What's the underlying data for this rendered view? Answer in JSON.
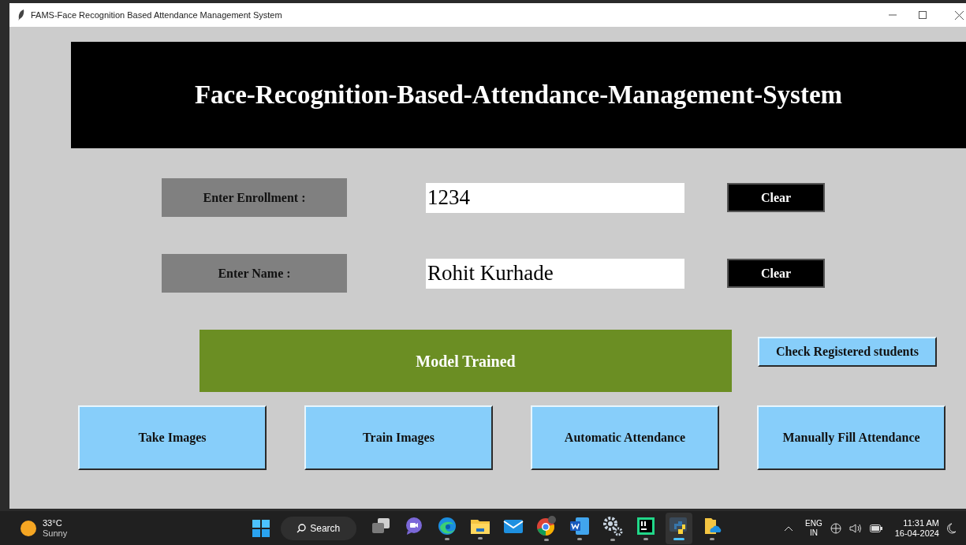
{
  "window": {
    "title": "FAMS-Face Recognition Based Attendance Management System"
  },
  "banner": {
    "title": "Face-Recognition-Based-Attendance-Management-System"
  },
  "fields": [
    {
      "label": "Enter Enrollment :",
      "value": "1234",
      "button": "Clear"
    },
    {
      "label": "Enter Name :",
      "value": "Rohit Kurhade",
      "button": "Clear"
    }
  ],
  "status": {
    "text": "Model Trained"
  },
  "check_button": "Check Registered students",
  "actions": [
    "Take Images",
    "Train Images",
    "Automatic Attendance",
    "Manually Fill Attendance"
  ],
  "taskbar": {
    "weather": {
      "temperature": "33°C",
      "condition": "Sunny"
    },
    "search": "Search",
    "apps": [
      {
        "kind": "taskview",
        "running": false,
        "selected": false
      },
      {
        "kind": "meet",
        "running": false,
        "selected": false
      },
      {
        "kind": "edge",
        "running": true,
        "selected": false
      },
      {
        "kind": "folder",
        "running": true,
        "selected": false
      },
      {
        "kind": "mail",
        "running": false,
        "selected": false
      },
      {
        "kind": "chrome",
        "running": true,
        "selected": false
      },
      {
        "kind": "word",
        "running": true,
        "selected": false
      },
      {
        "kind": "gears",
        "running": true,
        "selected": false
      },
      {
        "kind": "pycharm",
        "running": true,
        "selected": false
      },
      {
        "kind": "python",
        "running": true,
        "selected": true
      },
      {
        "kind": "cloudfolder",
        "running": true,
        "selected": false
      }
    ],
    "language": [
      "ENG",
      "IN"
    ],
    "time": "11:31 AM",
    "date": "16-04-2024"
  }
}
